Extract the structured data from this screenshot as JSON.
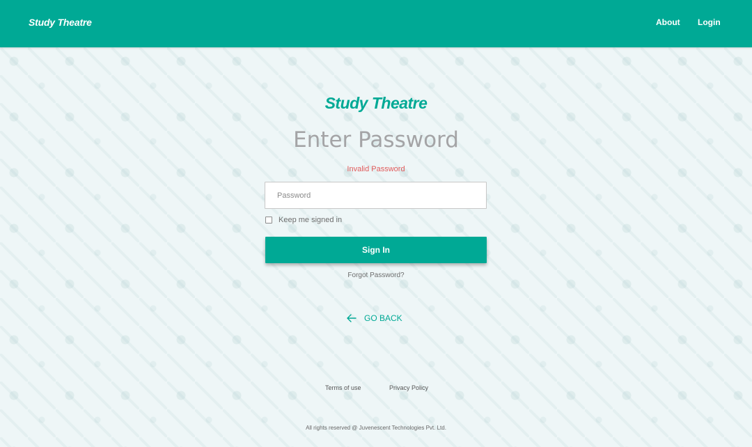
{
  "navbar": {
    "brand": "Study Theatre",
    "links": [
      {
        "label": "About"
      },
      {
        "label": "Login"
      }
    ]
  },
  "main": {
    "logo": "Study Theatre",
    "heading": "Enter Password",
    "error": "Invalid Password",
    "password_placeholder": "Password",
    "password_value": "",
    "keep_signed_in_label": "Keep me signed in",
    "keep_signed_in_checked": false,
    "signin_label": "Sign In",
    "forgot_label": "Forgot Password?",
    "go_back_label": "GO BACK",
    "go_back_icon": "arrow-left-icon"
  },
  "footer": {
    "terms": "Terms of use",
    "privacy": "Privacy Policy",
    "copyright": "All rights reserved @ Juvenescent Technologies Pvt. Ltd."
  },
  "colors": {
    "accent": "#00a995",
    "error": "#e05a5a",
    "heading": "#a4a4a6"
  }
}
